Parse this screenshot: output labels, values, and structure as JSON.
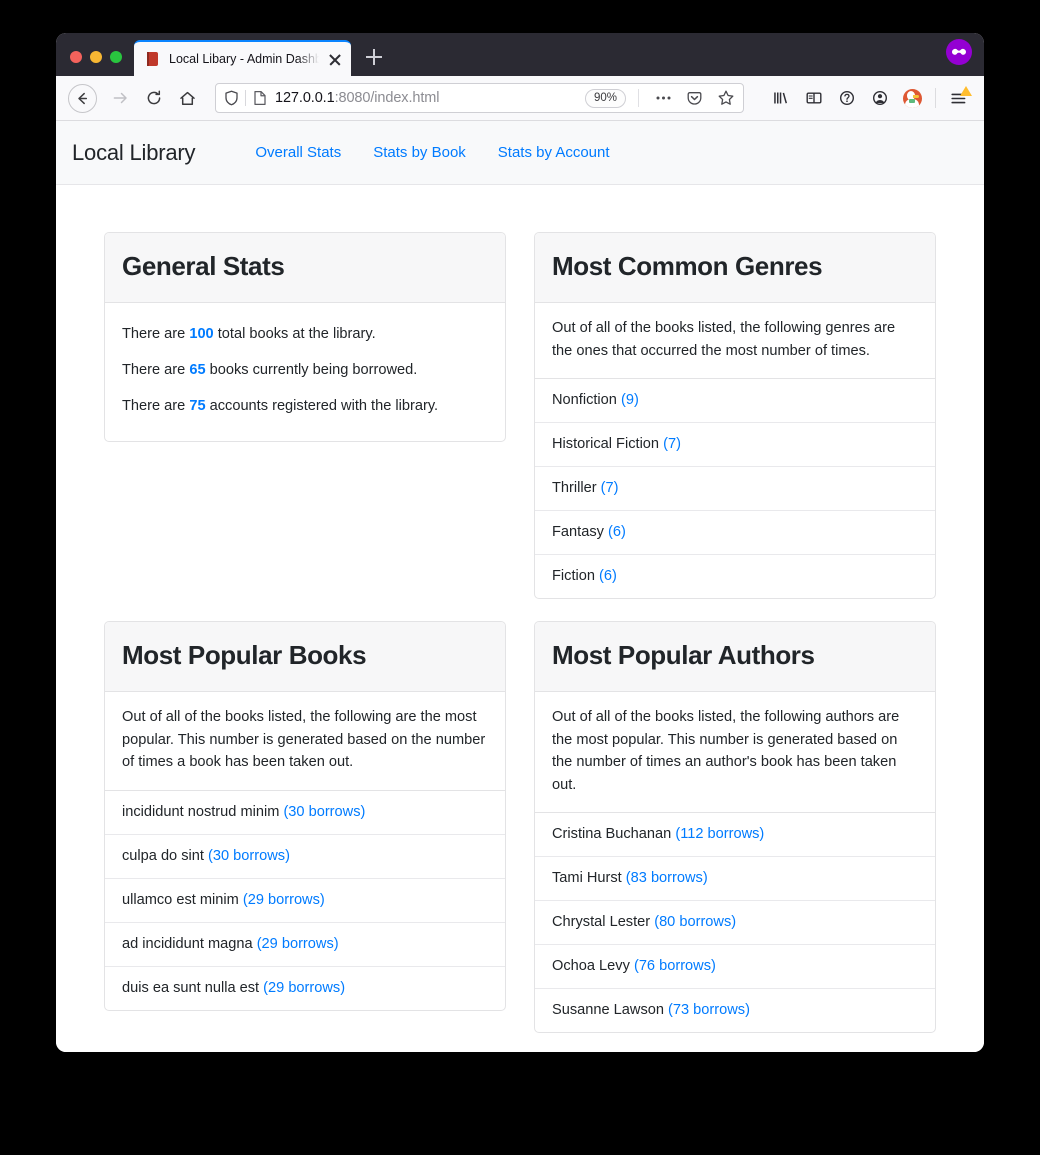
{
  "browser": {
    "tab": {
      "title": "Local Libary - Admin Dashboard",
      "favicon": "book-icon",
      "close": "close-icon"
    },
    "new_tab_label": "+",
    "container_badge": "mask-icon",
    "toolbar": {
      "back": "back-arrow-icon",
      "forward": "forward-arrow-icon",
      "reload": "reload-icon",
      "home": "home-icon",
      "shield": "shield-icon",
      "page_icon": "page-icon",
      "url_host": "127.0.0.1",
      "url_path": ":8080/index.html",
      "zoom_level": "90%",
      "page_actions": "ellipsis-icon",
      "pocket": "pocket-icon",
      "bookmark": "star-icon",
      "library": "library-icon",
      "sidebar": "sidebar-icon",
      "sync": "sync-icon",
      "account": "account-icon",
      "extension": "duckduckgo-icon",
      "app_menu": "hamburger-menu-icon"
    }
  },
  "site": {
    "brand": "Local Library",
    "nav_links": [
      {
        "label": "Overall Stats"
      },
      {
        "label": "Stats by Book"
      },
      {
        "label": "Stats by Account"
      }
    ]
  },
  "cards": {
    "general_stats": {
      "title": "General Stats",
      "lines": [
        {
          "before": "There are ",
          "value": "100",
          "after": " total books at the library."
        },
        {
          "before": "There are ",
          "value": "65",
          "after": " books currently being borrowed."
        },
        {
          "before": "There are ",
          "value": "75",
          "after": " accounts registered with the library."
        }
      ]
    },
    "common_genres": {
      "title": "Most Common Genres",
      "description": "Out of all of the books listed, the following genres are the ones that occurred the most number of times.",
      "items": [
        {
          "name": "Nonfiction",
          "count": "(9)"
        },
        {
          "name": "Historical Fiction",
          "count": "(7)"
        },
        {
          "name": "Thriller",
          "count": "(7)"
        },
        {
          "name": "Fantasy",
          "count": "(6)"
        },
        {
          "name": "Fiction",
          "count": "(6)"
        }
      ]
    },
    "popular_books": {
      "title": "Most Popular Books",
      "description": "Out of all of the books listed, the following are the most popular. This number is generated based on the number of times a book has been taken out.",
      "items": [
        {
          "name": "incididunt nostrud minim",
          "count": "(30 borrows)"
        },
        {
          "name": "culpa do sint",
          "count": "(30 borrows)"
        },
        {
          "name": "ullamco est minim",
          "count": "(29 borrows)"
        },
        {
          "name": "ad incididunt magna",
          "count": "(29 borrows)"
        },
        {
          "name": "duis ea sunt nulla est",
          "count": "(29 borrows)"
        }
      ]
    },
    "popular_authors": {
      "title": "Most Popular Authors",
      "description": "Out of all of the books listed, the following authors are the most popular. This number is generated based on the number of times an author's book has been taken out.",
      "items": [
        {
          "name": "Cristina Buchanan",
          "count": "(112 borrows)"
        },
        {
          "name": "Tami Hurst",
          "count": "(83 borrows)"
        },
        {
          "name": "Chrystal Lester",
          "count": "(80 borrows)"
        },
        {
          "name": "Ochoa Levy",
          "count": "(76 borrows)"
        },
        {
          "name": "Susanne Lawson",
          "count": "(73 borrows)"
        }
      ]
    }
  },
  "colors": {
    "link": "#007bff",
    "accent_tab": "#0a84ff",
    "container": "#9400d3"
  }
}
